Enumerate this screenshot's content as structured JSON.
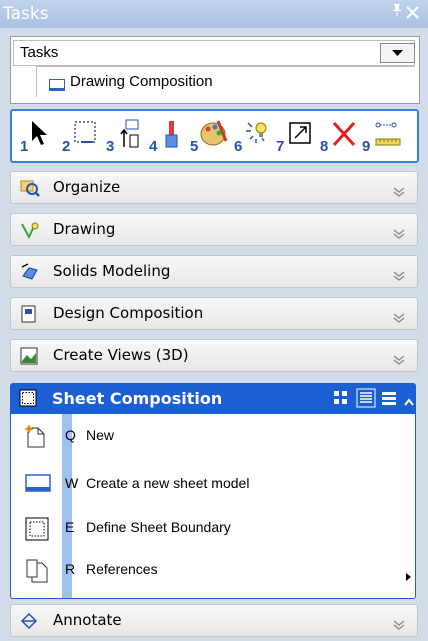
{
  "window": {
    "title": "Tasks",
    "pin_glyph": "ɨ",
    "close_glyph": "✕"
  },
  "tasks_dropdown": {
    "selected": "Tasks",
    "sub_item": "Drawing Composition"
  },
  "toolbar": {
    "tools": [
      {
        "num": "1",
        "icon": "select-arrow-icon"
      },
      {
        "num": "2",
        "icon": "fence-icon"
      },
      {
        "num": "3",
        "icon": "manipulate-icon"
      },
      {
        "num": "4",
        "icon": "paint-brush-icon"
      },
      {
        "num": "5",
        "icon": "palette-icon"
      },
      {
        "num": "6",
        "icon": "light-bulb-icon"
      },
      {
        "num": "7",
        "icon": "scale-icon"
      },
      {
        "num": "8",
        "icon": "delete-x-icon"
      },
      {
        "num": "9",
        "icon": "measure-icon"
      }
    ]
  },
  "sections": [
    {
      "label": "Organize",
      "icon": "organize-icon"
    },
    {
      "label": "Drawing",
      "icon": "drawing-icon"
    },
    {
      "label": "Solids Modeling",
      "icon": "solids-icon"
    },
    {
      "label": "Design Composition",
      "icon": "design-composition-icon"
    },
    {
      "label": "Create Views (3D)",
      "icon": "create-views-icon"
    }
  ],
  "expanded_section": {
    "label": "Sheet Composition",
    "commands": [
      {
        "key": "Q",
        "label": "New",
        "icon": "new-icon"
      },
      {
        "key": "W",
        "label": "Create a new sheet model",
        "icon": "sheet-model-icon"
      },
      {
        "key": "E",
        "label": "Define Sheet Boundary",
        "icon": "sheet-boundary-icon"
      },
      {
        "key": "R",
        "label": "References",
        "icon": "references-icon",
        "submenu": true
      }
    ]
  },
  "bottom_section": {
    "label": "Annotate",
    "icon": "annotate-icon"
  },
  "colors": {
    "accent": "#1b5fd2",
    "title_bar": "#b4c8e6",
    "tool_number": "#2452b4"
  }
}
